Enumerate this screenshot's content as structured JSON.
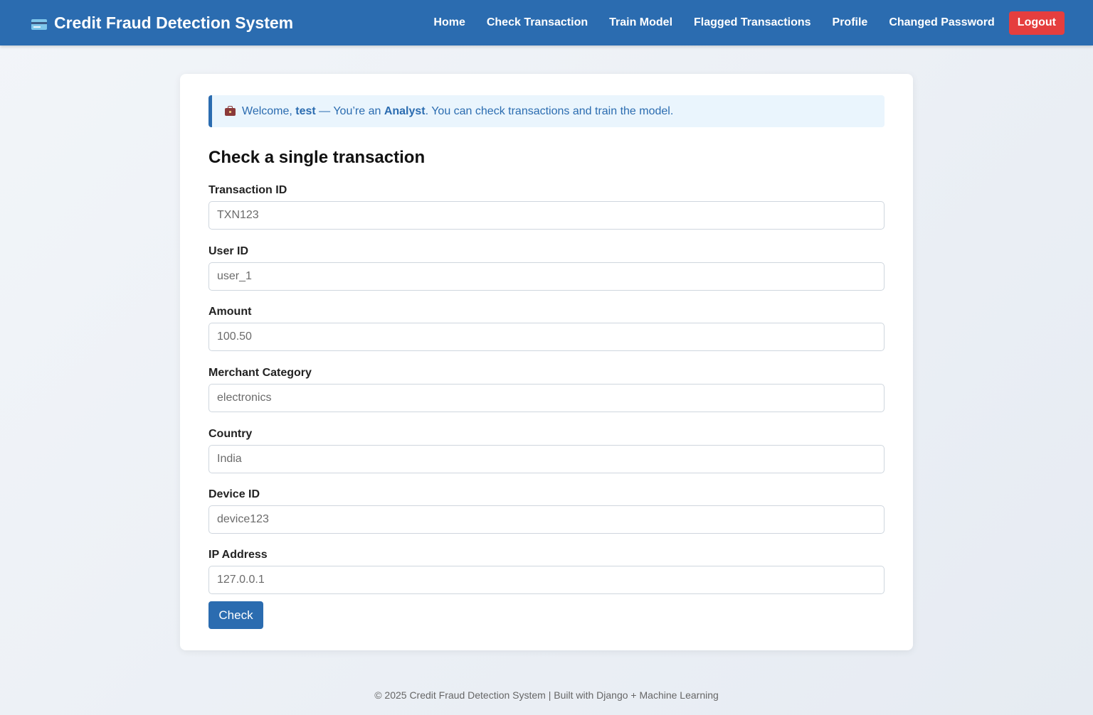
{
  "app": {
    "title": "Credit Fraud Detection System",
    "brand_icon": "credit-card-icon"
  },
  "nav": {
    "items": [
      {
        "label": "Home"
      },
      {
        "label": "Check Transaction"
      },
      {
        "label": "Train Model"
      },
      {
        "label": "Flagged Transactions"
      },
      {
        "label": "Profile"
      },
      {
        "label": "Changed Password"
      }
    ],
    "logout_label": "Logout"
  },
  "welcome": {
    "icon": "briefcase-icon",
    "prefix": "Welcome, ",
    "username": "test",
    "middle": " — You’re an ",
    "role": "Analyst",
    "suffix": ". You can check transactions and train the model."
  },
  "form": {
    "title": "Check a single transaction",
    "fields": [
      {
        "label": "Transaction ID",
        "placeholder": "TXN123",
        "value": ""
      },
      {
        "label": "User ID",
        "placeholder": "user_1",
        "value": ""
      },
      {
        "label": "Amount",
        "placeholder": "100.50",
        "value": ""
      },
      {
        "label": "Merchant Category",
        "placeholder": "electronics",
        "value": ""
      },
      {
        "label": "Country",
        "placeholder": "India",
        "value": ""
      },
      {
        "label": "Device ID",
        "placeholder": "device123",
        "value": ""
      },
      {
        "label": "IP Address",
        "placeholder": "127.0.0.1",
        "value": ""
      }
    ],
    "submit_label": "Check"
  },
  "footer": {
    "text": "© 2025 Credit Fraud Detection System | Built with Django + Machine Learning"
  },
  "colors": {
    "primary": "#2b6cb0",
    "danger": "#e53e3e",
    "alert_bg": "#eaf5fd"
  }
}
